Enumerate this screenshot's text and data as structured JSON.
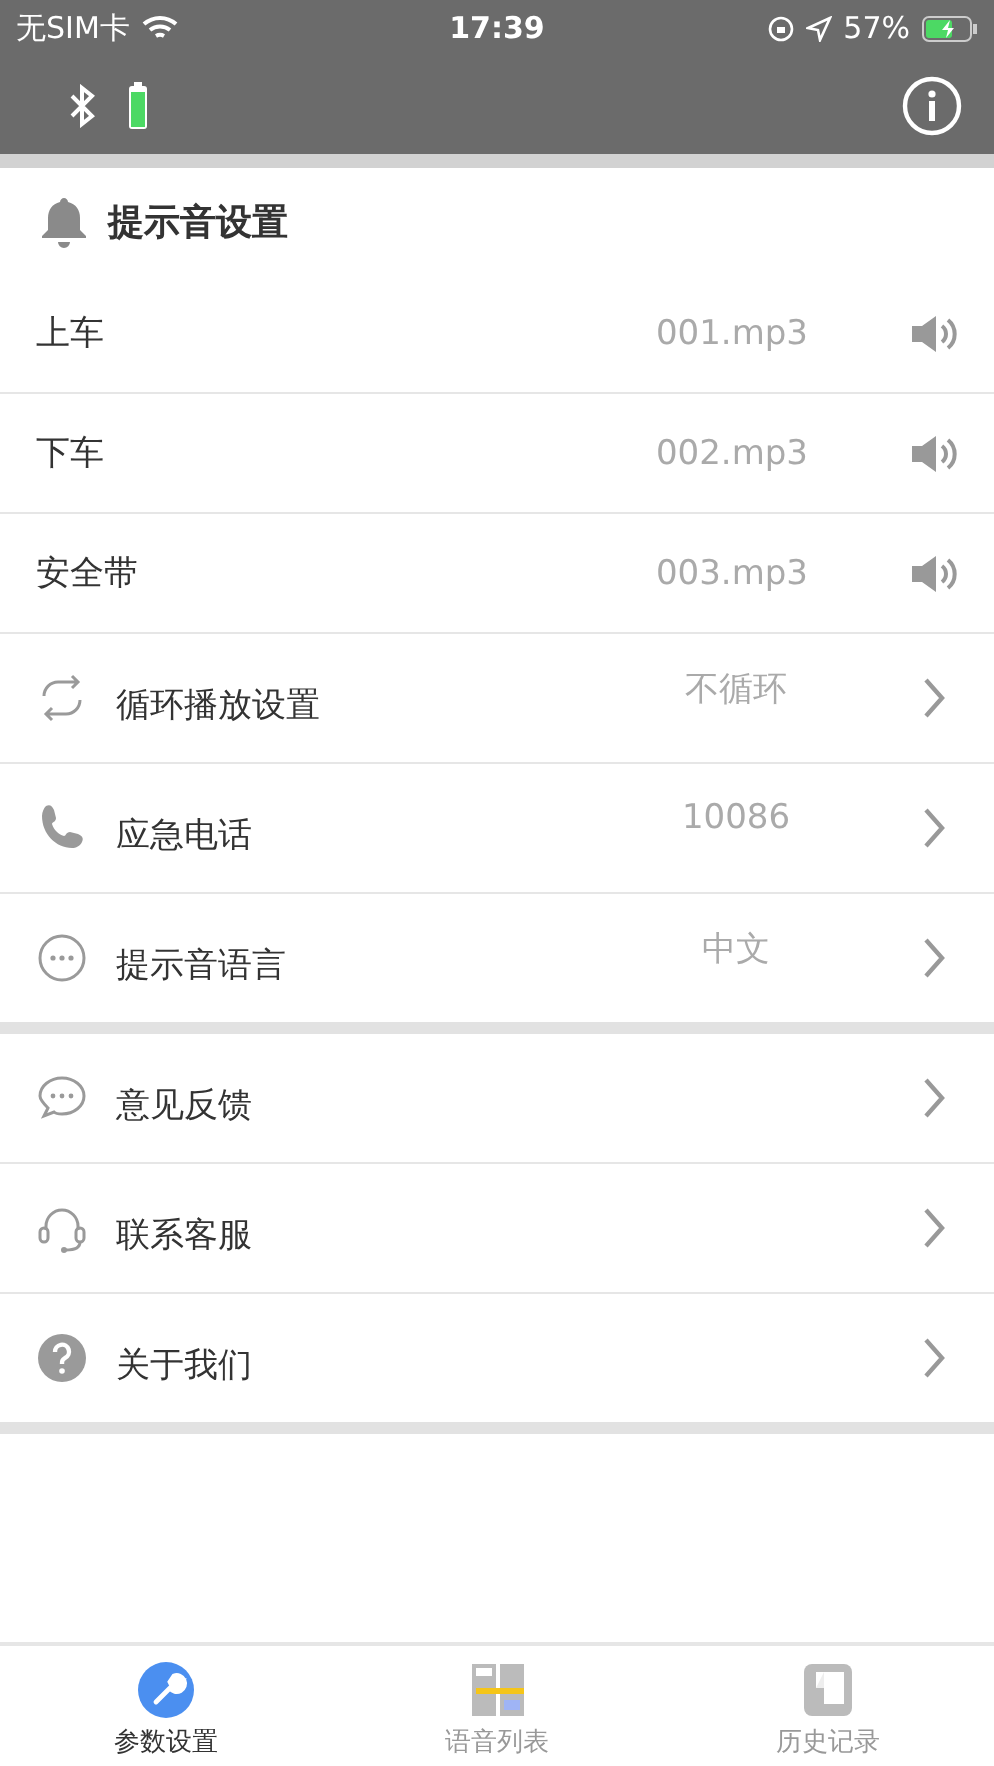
{
  "status_bar": {
    "carrier": "无SIM卡",
    "time": "17:39",
    "battery": "57%"
  },
  "section": {
    "title": "提示音设置"
  },
  "sounds": [
    {
      "label": "上车",
      "file": "001.mp3"
    },
    {
      "label": "下车",
      "file": "002.mp3"
    },
    {
      "label": "安全带",
      "file": "003.mp3"
    }
  ],
  "settings": [
    {
      "label": "循环播放设置",
      "value": "不循环"
    },
    {
      "label": "应急电话",
      "value": "10086"
    },
    {
      "label": "提示音语言",
      "value": "中文"
    }
  ],
  "more": [
    {
      "label": "意见反馈"
    },
    {
      "label": "联系客服"
    },
    {
      "label": "关于我们"
    }
  ],
  "tabs": [
    {
      "label": "参数设置",
      "selected": true
    },
    {
      "label": "语音列表",
      "selected": false
    },
    {
      "label": "历史记录",
      "selected": false
    }
  ]
}
